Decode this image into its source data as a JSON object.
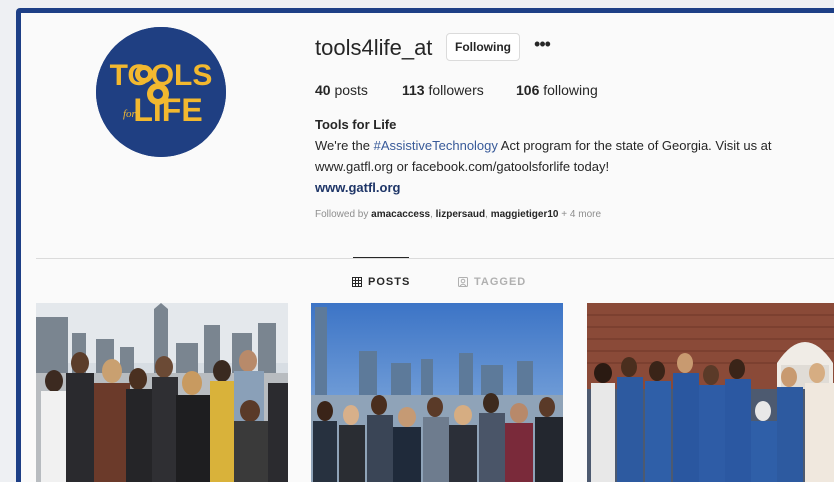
{
  "profile": {
    "username": "tools4life_at",
    "follow_label": "Following",
    "more_label": "•••",
    "logo_text_top": "TOOLS",
    "logo_text_for": "for",
    "logo_text_bottom": "LIFE"
  },
  "stats": {
    "posts_count": "40",
    "posts_label": "posts",
    "followers_count": "113",
    "followers_label": "followers",
    "following_count": "106",
    "following_label": "following"
  },
  "bio": {
    "name": "Tools for Life",
    "line1_pre": "We're the ",
    "hashtag": "#AssistiveTechnology",
    "line1_post": " Act program for the state of Georgia. Visit us at",
    "line2": "www.gatfl.org or facebook.com/gatoolsforlife today!",
    "link": "www.gatfl.org"
  },
  "followed_by": {
    "prefix": "Followed by ",
    "user1": "amacaccess",
    "sep1": ", ",
    "user2": "lizpersaud",
    "sep2": ", ",
    "user3": "maggietiger10",
    "suffix": " + 4 more"
  },
  "tabs": {
    "posts": "POSTS",
    "tagged": "TAGGED"
  },
  "colors": {
    "frame": "#1d3f86",
    "logo_bg": "#1f3f82",
    "logo_gold": "#f2b82f",
    "link": "#1e3567",
    "hashtag": "#385a99"
  },
  "icons": {
    "grid": "grid-icon",
    "tag": "tag-icon",
    "gear": "gear-icon"
  }
}
